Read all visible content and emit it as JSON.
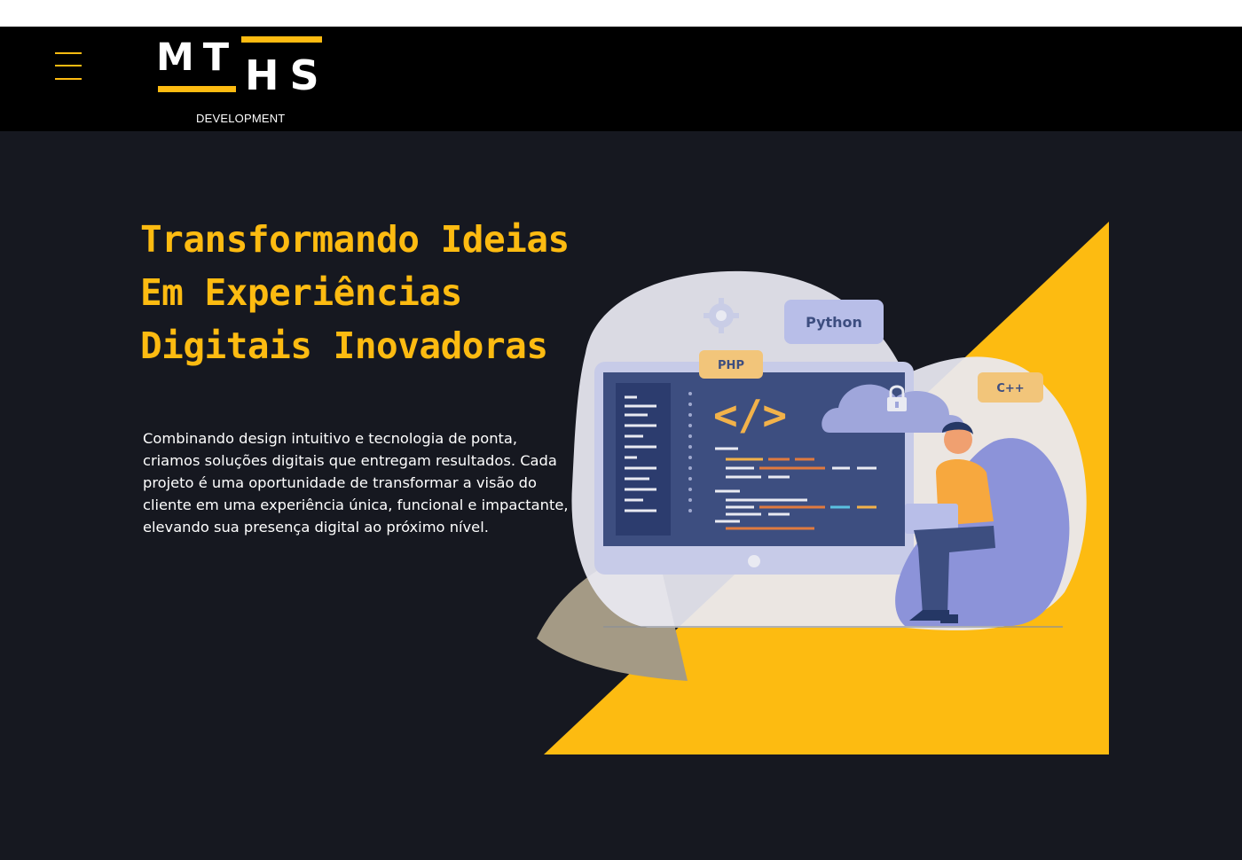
{
  "header": {
    "logo_letters_top": "MT",
    "logo_letters_bottom": "HS",
    "logo_subtitle": "DEVELOPMENT",
    "menu_icon": "hamburger-menu-icon"
  },
  "hero": {
    "title_lines": [
      "Transformando Ideias",
      "Em Experiências",
      "Digitais Inovadoras"
    ],
    "description": "Combinando design intuitivo e tecnologia de ponta, criamos soluções digitais que entregam resultados. Cada projeto é uma oportunidade de transformar a visão do cliente em uma experiência única, funcional e impactante, elevando sua presença digital ao próximo nível."
  },
  "illustration": {
    "tags": [
      "Python",
      "PHP",
      "C++"
    ],
    "code_symbol": "</>",
    "icons": [
      "gear-icon",
      "cloud-lock-icon"
    ]
  },
  "colors": {
    "accent": "#FDBB11",
    "background": "#161820",
    "header": "#000000"
  }
}
